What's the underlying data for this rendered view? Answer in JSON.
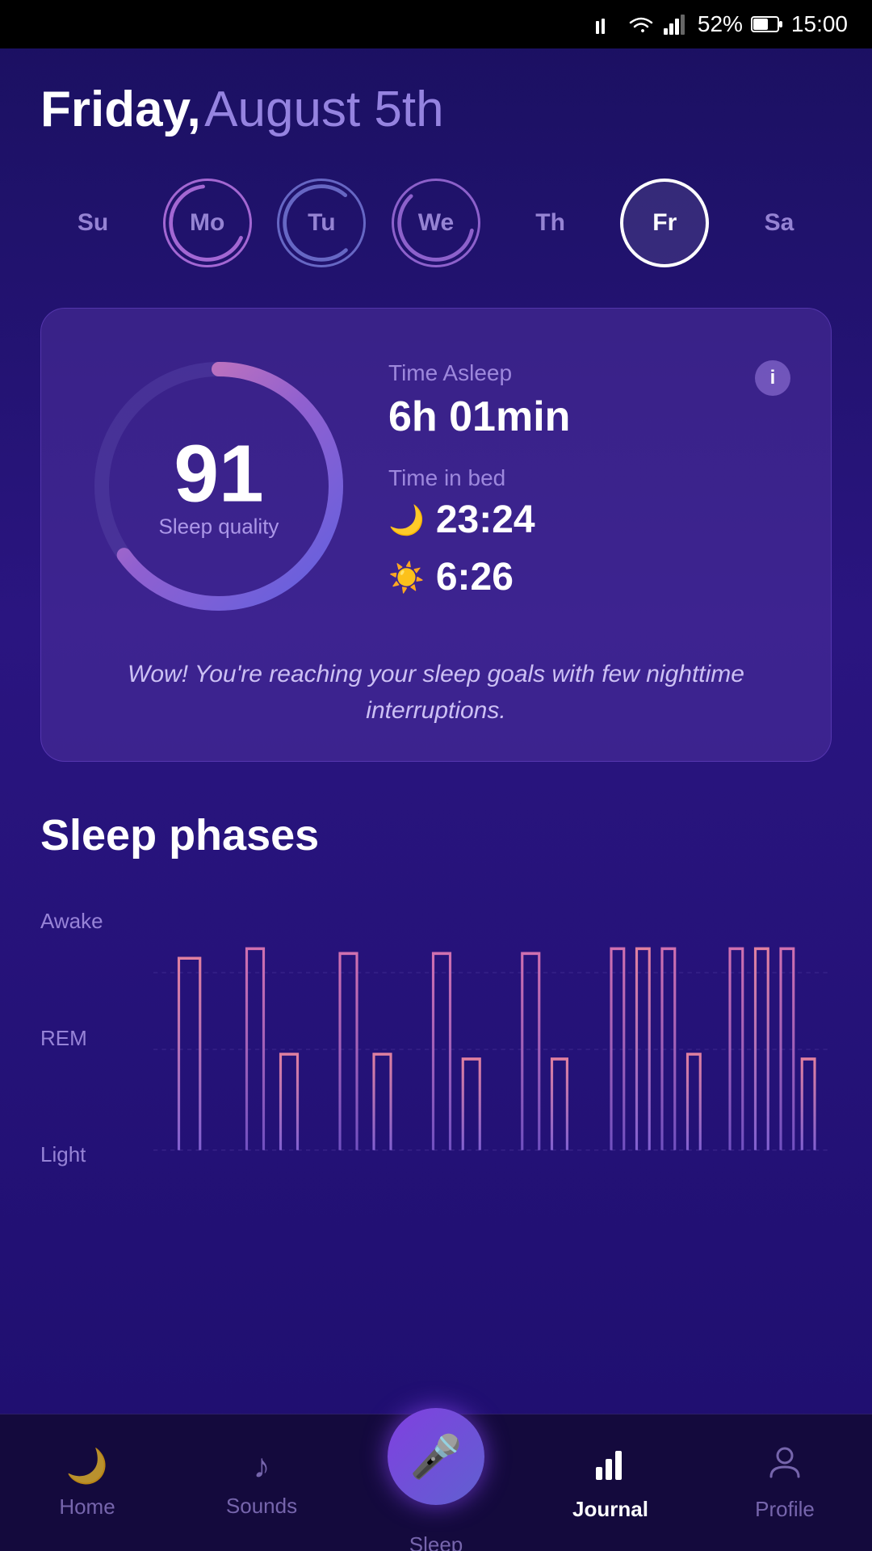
{
  "statusBar": {
    "battery": "52%",
    "time": "15:00"
  },
  "header": {
    "dayName": "Friday,",
    "dayDate": "August 5th"
  },
  "weekDays": [
    {
      "label": "Su",
      "active": false,
      "hasData": false,
      "id": "su"
    },
    {
      "label": "Mo",
      "active": false,
      "hasData": true,
      "arcColor": "#d080e0",
      "id": "mo"
    },
    {
      "label": "Tu",
      "active": false,
      "hasData": true,
      "arcColor": "#9090d0",
      "id": "tu"
    },
    {
      "label": "We",
      "active": false,
      "hasData": true,
      "arcColor": "#c080e0",
      "id": "we"
    },
    {
      "label": "Th",
      "active": false,
      "hasData": false,
      "id": "th"
    },
    {
      "label": "Fr",
      "active": true,
      "hasData": false,
      "id": "fr"
    },
    {
      "label": "Sa",
      "active": false,
      "hasData": false,
      "id": "sa"
    }
  ],
  "sleepCard": {
    "score": "91",
    "scoreLabel": "Sleep quality",
    "timeAsleepLabel": "Time Asleep",
    "timeAsleepValue": "6h 01min",
    "timeInBedLabel": "Time in bed",
    "bedtimeIcon": "🌙",
    "bedtimeValue": "23:24",
    "wakeIcon": "☀️",
    "wakeValue": "6:26",
    "message": "Wow! You're reaching your sleep goals with few nighttime interruptions.",
    "infoIcon": "i"
  },
  "sleepPhases": {
    "title": "Sleep phases",
    "labels": [
      "Awake",
      "REM",
      "Light"
    ],
    "chartNote": "Sleep phase timeline chart"
  },
  "bottomNav": [
    {
      "id": "home",
      "icon": "🌙",
      "label": "Home",
      "active": false
    },
    {
      "id": "sounds",
      "icon": "🎵",
      "label": "Sounds",
      "active": false
    },
    {
      "id": "sleep",
      "icon": "🎤",
      "label": "Sleep",
      "active": false,
      "isCenter": true
    },
    {
      "id": "journal",
      "icon": "📊",
      "label": "Journal",
      "active": true
    },
    {
      "id": "profile",
      "icon": "👤",
      "label": "Profile",
      "active": false
    }
  ]
}
